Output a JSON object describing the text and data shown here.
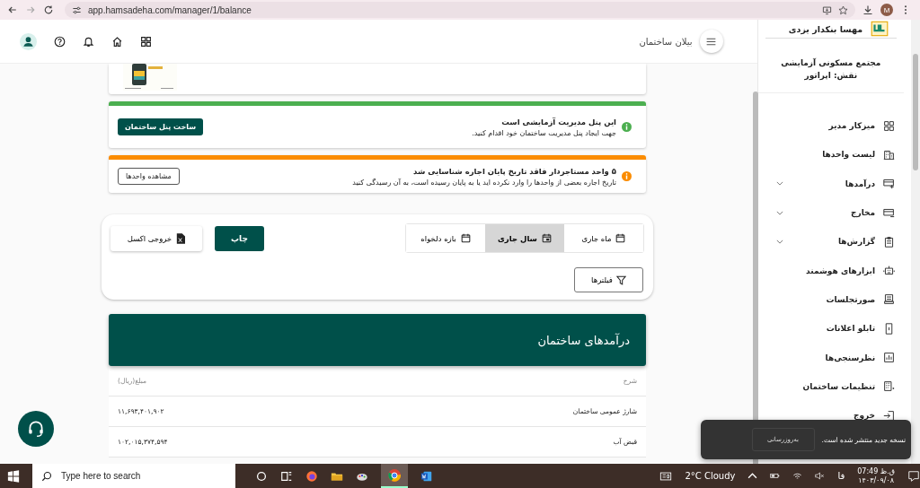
{
  "browser": {
    "url": "app.hamsadeha.com/manager/1/balance",
    "profile": "M"
  },
  "header": {
    "title": "بیلان ساختمان"
  },
  "alerts": [
    {
      "kind": "success",
      "title": "این پنل مدیریت آزمایشی است",
      "message": "جهت ایجاد پنل مدیریت ساختمان خود اقدام کنید.",
      "action": "ساخت پنل ساختمان"
    },
    {
      "kind": "warning",
      "title": "۵ واحد مستاجردار فاقد تاریخ پایان اجاره شناسایی شد",
      "message": "تاریخ اجاره بعضی از واحدها را وارد نکرده اید یا به پایان رسیده است، به آن رسیدگی کنید",
      "action": "مشاهده واحدها"
    }
  ],
  "period_tabs": [
    {
      "label": "ماه جاری",
      "selected": false
    },
    {
      "label": "سال جاری",
      "selected": true
    },
    {
      "label": "بازه دلخواه",
      "selected": false
    }
  ],
  "print_button": "چاپ",
  "excel_button": "خروجی اکسل",
  "filters_button": "فیلترها",
  "income": {
    "title": "درآمدهای ساختمان",
    "columns": [
      "شرح",
      "مبلغ(ریال)"
    ],
    "rows": [
      [
        "شارژ عمومی ساختمان",
        "۱۱,۶۹۳,۴۰۱,۹۰۲"
      ],
      [
        "قبض آب",
        "۱۰۲,۰۱۵,۳۷۴,۵۹۴"
      ]
    ]
  },
  "sidebar": {
    "user": "مهسا بنکدار یزدی",
    "complex": "مجتمع مسکونی آزمایشی",
    "role": "نقش: اپراتور",
    "items": [
      {
        "label": "میزکار مدیر",
        "kind": "link"
      },
      {
        "label": "لیست واحدها",
        "kind": "link"
      },
      {
        "label": "درآمدها",
        "kind": "group"
      },
      {
        "label": "مخارج",
        "kind": "group"
      },
      {
        "label": "گزارش‌ها",
        "kind": "group"
      },
      {
        "label": "ابزارهای هوشمند",
        "kind": "link"
      },
      {
        "label": "صورتجلسات",
        "kind": "link"
      },
      {
        "label": "تابلو اعلانات",
        "kind": "link"
      },
      {
        "label": "نظرسنجی‌ها",
        "kind": "link"
      },
      {
        "label": "تنظیمات ساختمان",
        "kind": "link"
      },
      {
        "label": "خروج",
        "kind": "link"
      }
    ]
  },
  "toast": {
    "message": "نسخه جدید منتشر شده است.",
    "action": "به‌روزرسانی"
  },
  "taskbar": {
    "search_placeholder": "Type here to search",
    "weather": "2°C Cloudy",
    "language": "فا",
    "time": "ق.ظ 07:49",
    "date": "۱۴۰۳/۰۹/۰۸"
  }
}
